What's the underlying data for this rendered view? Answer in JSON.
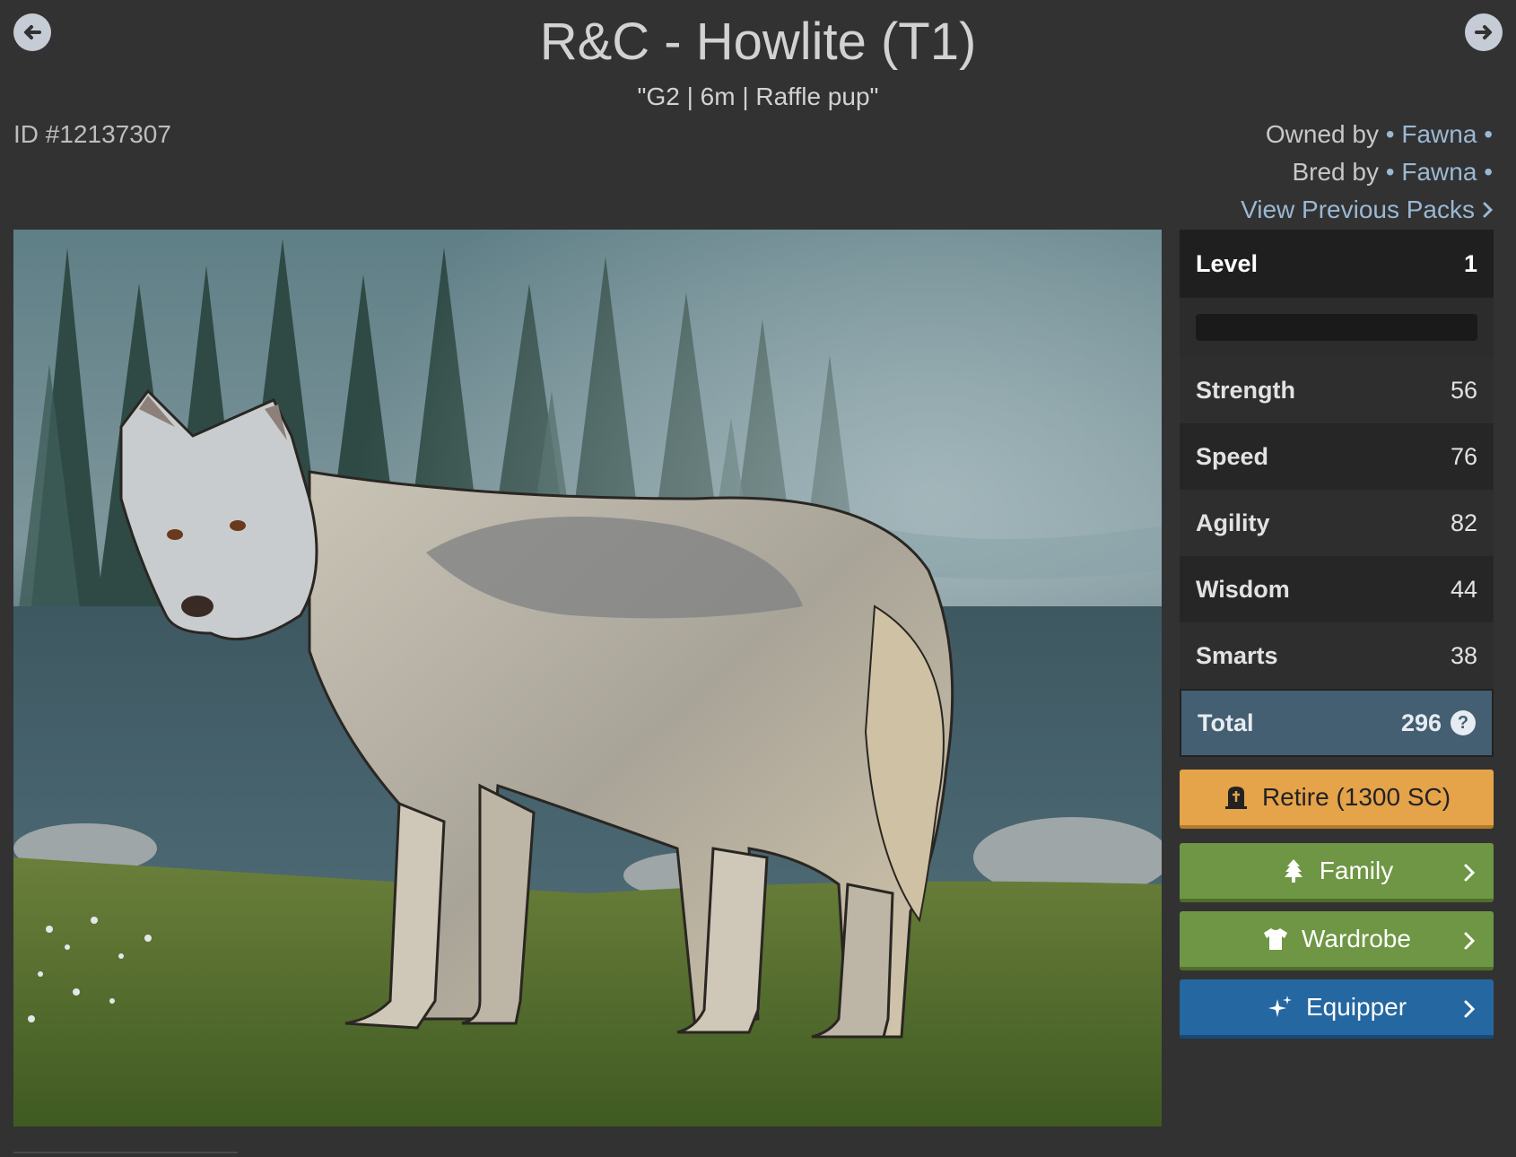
{
  "header": {
    "title": "R&C - Howlite (T1)",
    "subtitle": "\"G2 | 6m | Raffle pup\"",
    "id_text": "ID #12137307"
  },
  "owner": {
    "owned_label": "Owned by",
    "owned_name": "Fawna",
    "bred_label": "Bred by",
    "bred_name": "Fawna",
    "packs_link": "View Previous Packs"
  },
  "stats": {
    "level_label": "Level",
    "level_value": "1",
    "xp_progress": 0,
    "rows": [
      {
        "label": "Strength",
        "value": "56"
      },
      {
        "label": "Speed",
        "value": "76"
      },
      {
        "label": "Agility",
        "value": "82"
      },
      {
        "label": "Wisdom",
        "value": "44"
      },
      {
        "label": "Smarts",
        "value": "38"
      }
    ],
    "total_label": "Total",
    "total_value": "296"
  },
  "actions": {
    "retire": "Retire (1300 SC)",
    "family": "Family",
    "wardrobe": "Wardrobe",
    "equipper": "Equipper"
  },
  "icons": {
    "prev": "arrow-left-circle-icon",
    "next": "arrow-right-circle-icon",
    "help": "question-circle-icon",
    "retire": "tombstone-icon",
    "family": "tree-icon",
    "wardrobe": "tshirt-icon",
    "equipper": "sparkles-icon"
  },
  "colors": {
    "background": "#323232",
    "link": "#9ab8d4",
    "retire": "#e5a34a",
    "green": "#6e9644",
    "blue": "#2467a1",
    "total": "#445e72"
  }
}
